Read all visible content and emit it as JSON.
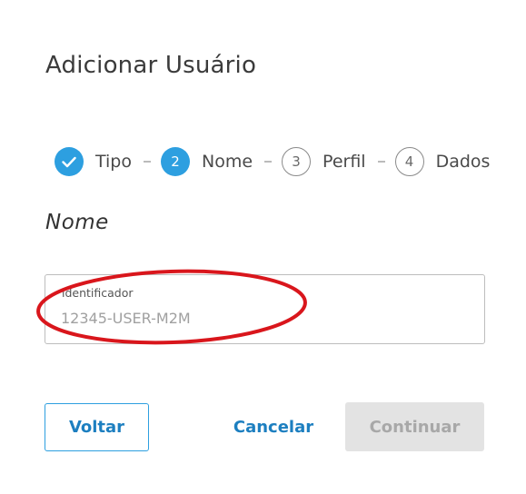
{
  "dialog": {
    "title": "Adicionar Usuário"
  },
  "stepper": {
    "steps": [
      {
        "number": "",
        "label": "Tipo",
        "state": "done"
      },
      {
        "number": "2",
        "label": "Nome",
        "state": "active"
      },
      {
        "number": "3",
        "label": "Perfil",
        "state": "todo"
      },
      {
        "number": "4",
        "label": "Dados",
        "state": "todo"
      }
    ]
  },
  "section": {
    "title": "Nome"
  },
  "identifier_field": {
    "label": "identificador",
    "value": "",
    "placeholder": "12345-USER-M2M"
  },
  "annotation": {
    "color": "#d9161c",
    "shape": "ellipse"
  },
  "buttons": {
    "back": "Voltar",
    "cancel": "Cancelar",
    "continue": "Continuar"
  },
  "colors": {
    "accent": "#2d9fe0",
    "disabled_bg": "#e3e3e3",
    "disabled_text": "#a8a8a8"
  }
}
